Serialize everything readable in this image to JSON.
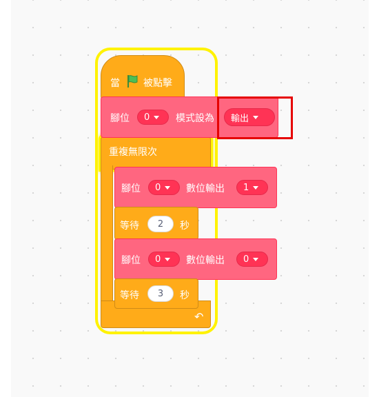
{
  "hat_block": {
    "label_when": "當",
    "label_clicked": "被點擊",
    "flag_icon": "green-flag-icon"
  },
  "pin_mode_block": {
    "label_pin": "腳位",
    "pin_value": "0",
    "label_mode": "模式設為",
    "mode_value": "輸出"
  },
  "forever_block": {
    "label": "重複無限次",
    "loop_icon": "loop-arrow-icon"
  },
  "digital_write_1": {
    "label_pin": "腳位",
    "pin_value": "0",
    "label_action": "數位輸出",
    "value": "1"
  },
  "wait_1": {
    "label_wait": "等待",
    "seconds": "2",
    "label_unit": "秒"
  },
  "digital_write_2": {
    "label_pin": "腳位",
    "pin_value": "0",
    "label_action": "數位輸出",
    "value": "0"
  },
  "wait_2": {
    "label_wait": "等待",
    "seconds": "3",
    "label_unit": "秒"
  },
  "colors": {
    "control_orange": "#ffab19",
    "arduino_pink": "#ff6680",
    "highlight_red": "#e60000",
    "glow_yellow": "#fff200"
  }
}
